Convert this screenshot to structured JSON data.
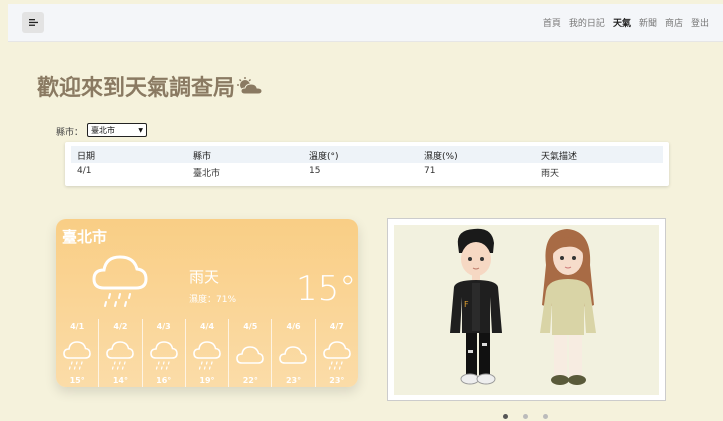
{
  "nav": {
    "links": [
      "首頁",
      "我的日記",
      "天氣",
      "新聞",
      "商店",
      "登出"
    ],
    "active_index": 2
  },
  "page": {
    "title": "歡迎來到天氣調查局"
  },
  "filter": {
    "label": "縣市：",
    "selected": "臺北市"
  },
  "table": {
    "headers": [
      "日期",
      "縣市",
      "溫度(°)",
      "濕度(%)",
      "天氣描述"
    ],
    "rows": [
      [
        "4/1",
        "臺北市",
        "15",
        "71",
        "雨天"
      ]
    ]
  },
  "weather_card": {
    "city": "臺北市",
    "description": "雨天",
    "humidity": "濕度：71%",
    "temperature": "15°",
    "forecast": [
      {
        "date": "4/1",
        "temp": "15°",
        "icon": "rain-cloud-icon"
      },
      {
        "date": "4/2",
        "temp": "14°",
        "icon": "rain-cloud-icon"
      },
      {
        "date": "4/3",
        "temp": "16°",
        "icon": "rain-cloud-icon"
      },
      {
        "date": "4/4",
        "temp": "19°",
        "icon": "rain-cloud-icon"
      },
      {
        "date": "4/5",
        "temp": "22°",
        "icon": "cloud-icon"
      },
      {
        "date": "4/6",
        "temp": "23°",
        "icon": "cloud-icon"
      },
      {
        "date": "4/7",
        "temp": "23°",
        "icon": "rain-cloud-icon"
      }
    ]
  },
  "carousel": {
    "slide_count": 3,
    "active_slide": 1
  },
  "colors": {
    "background": "#f5f2dc",
    "card_gradient_top": "#f9ce85",
    "title": "#8a7a62"
  }
}
